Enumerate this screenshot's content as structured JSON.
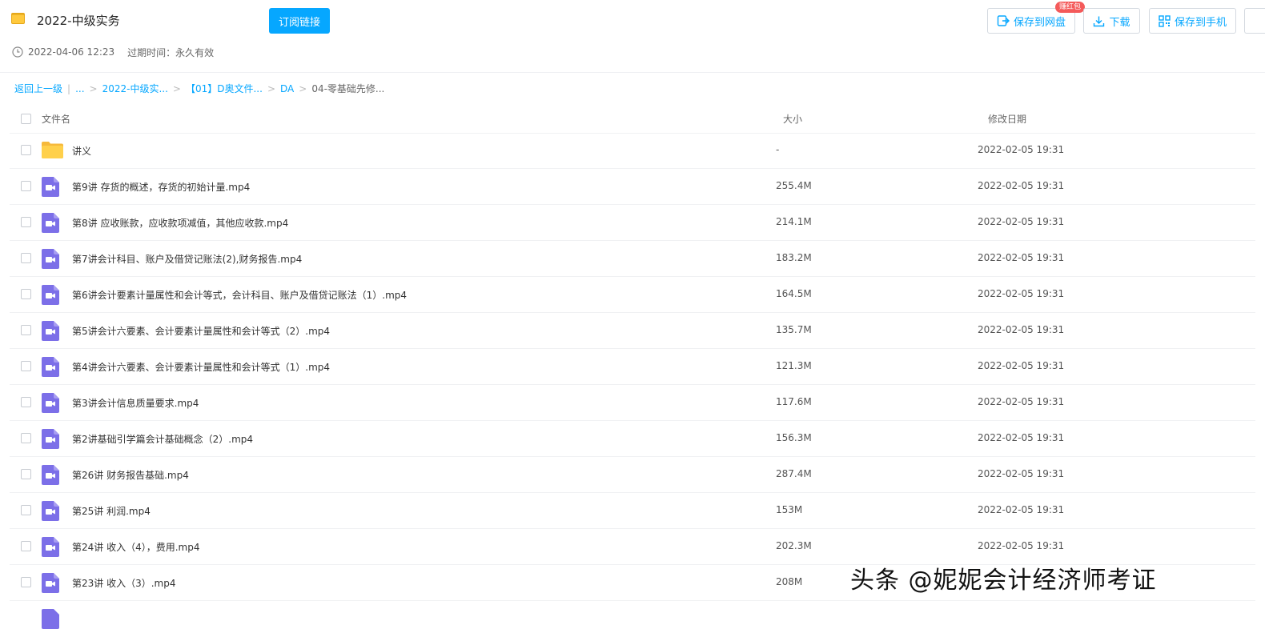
{
  "share": {
    "title": "2022-中级实务",
    "subscribe_label": "订阅链接",
    "created": "2022-04-06 12:23",
    "expire_label": "过期时间：永久有效"
  },
  "toolbar": {
    "save_netdisk_label": "保存到网盘",
    "save_badge": "赚红包",
    "download_label": "下载",
    "save_phone_label": "保存到手机"
  },
  "breadcrumb": {
    "back": "返回上一级",
    "ellipsis": "...",
    "items": [
      "2022-中级实...",
      "【01】D奥文件...",
      "DA"
    ],
    "current": "04-零基础先修..."
  },
  "columns": {
    "name": "文件名",
    "size": "大小",
    "date": "修改日期"
  },
  "files": [
    {
      "name": "讲义",
      "size": "-",
      "date": "2022-02-05 19:31",
      "type": "folder"
    },
    {
      "name": "第9讲 存货的概述，存货的初始计量.mp4",
      "size": "255.4M",
      "date": "2022-02-05 19:31",
      "type": "video"
    },
    {
      "name": "第8讲 应收账款，应收款项减值，其他应收款.mp4",
      "size": "214.1M",
      "date": "2022-02-05 19:31",
      "type": "video"
    },
    {
      "name": "第7讲会计科目、账户及借贷记账法(2),财务报告.mp4",
      "size": "183.2M",
      "date": "2022-02-05 19:31",
      "type": "video"
    },
    {
      "name": "第6讲会计要素计量属性和会计等式，会计科目、账户及借贷记账法（1）.mp4",
      "size": "164.5M",
      "date": "2022-02-05 19:31",
      "type": "video"
    },
    {
      "name": "第5讲会计六要素、会计要素计量属性和会计等式（2）.mp4",
      "size": "135.7M",
      "date": "2022-02-05 19:31",
      "type": "video"
    },
    {
      "name": "第4讲会计六要素、会计要素计量属性和会计等式（1）.mp4",
      "size": "121.3M",
      "date": "2022-02-05 19:31",
      "type": "video"
    },
    {
      "name": "第3讲会计信息质量要求.mp4",
      "size": "117.6M",
      "date": "2022-02-05 19:31",
      "type": "video"
    },
    {
      "name": "第2讲基础引学篇会计基础概念（2）.mp4",
      "size": "156.3M",
      "date": "2022-02-05 19:31",
      "type": "video"
    },
    {
      "name": "第26讲 财务报告基础.mp4",
      "size": "287.4M",
      "date": "2022-02-05 19:31",
      "type": "video"
    },
    {
      "name": "第25讲 利润.mp4",
      "size": "153M",
      "date": "2022-02-05 19:31",
      "type": "video"
    },
    {
      "name": "第24讲 收入（4），费用.mp4",
      "size": "202.3M",
      "date": "2022-02-05 19:31",
      "type": "video"
    },
    {
      "name": "第23讲 收入（3）.mp4",
      "size": "208M",
      "date": "",
      "type": "video"
    }
  ],
  "watermark": "头条 @妮妮会计经济师考证",
  "colors": {
    "accent": "#06a7ff",
    "folder": "#ffd04b",
    "video": "#7c6fe8",
    "badge": "#f45a5a"
  },
  "icons": {
    "folder": "folder-icon",
    "video": "video-file-icon",
    "clock": "clock-icon",
    "save": "save-to-cloud-icon",
    "download": "download-icon",
    "phone": "qr-phone-icon"
  }
}
